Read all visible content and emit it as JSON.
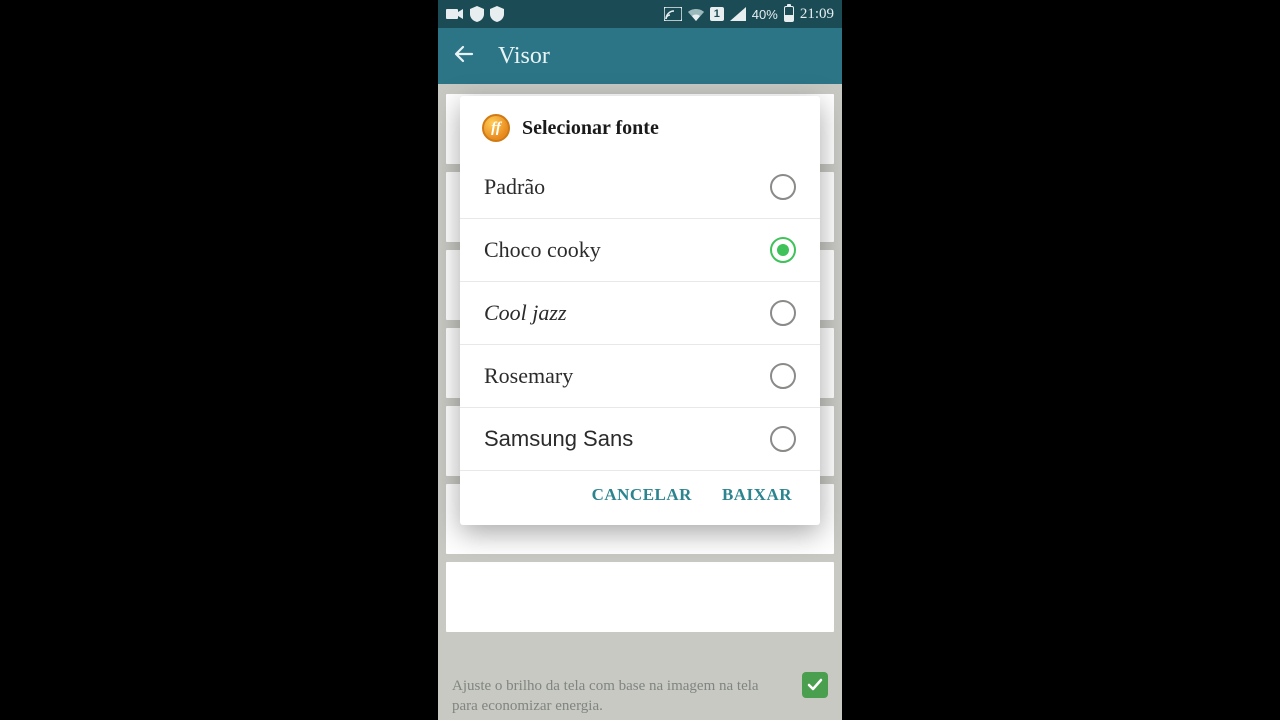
{
  "statusbar": {
    "sim_number": "1",
    "battery_text": "40%",
    "time": "21:09"
  },
  "appbar": {
    "title": "Visor"
  },
  "dialog": {
    "title": "Selecionar fonte",
    "icon_text": "ff",
    "options": [
      {
        "label": "Padrão",
        "selected": false
      },
      {
        "label": "Choco cooky",
        "selected": true
      },
      {
        "label": "Cool jazz",
        "selected": false
      },
      {
        "label": "Rosemary",
        "selected": false
      },
      {
        "label": "Samsung Sans",
        "selected": false
      }
    ],
    "cancel": "CANCELAR",
    "download": "BAIXAR"
  },
  "background": {
    "desc": "Ajuste o brilho da tela com base na imagem na tela para economizar energia."
  }
}
